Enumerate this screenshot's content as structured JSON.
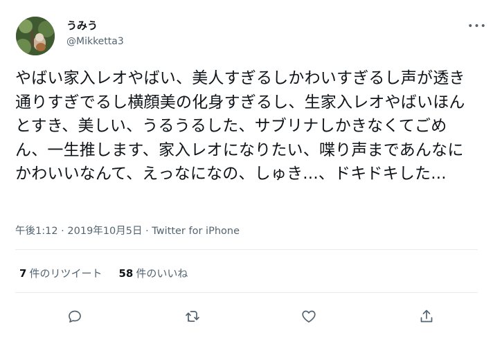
{
  "user": {
    "display_name": "うみう",
    "handle": "@Mikketta3"
  },
  "more_label": "•••",
  "tweet": {
    "text": "やばい家入レオやばい、美人すぎるしかわいすぎるし声が透き通りすぎでるし横顔美の化身すぎるし、生家入レオやばいほんとすき、美しい、うるうるした、サブリナしかきなくてごめん、一生推します、家入レオになりたい、喋り声まであんなにかわいいなんて、えっなになの、しゅき...、ドキドキした..."
  },
  "meta": {
    "time": "午後1:12",
    "separator1": " · ",
    "date": "2019年10月5日",
    "separator2": " · ",
    "source": "Twitter for iPhone"
  },
  "stats": {
    "retweets_count": "7",
    "retweets_label": "件のリツイート",
    "likes_count": "58",
    "likes_label": "件のいいね"
  },
  "icons": {
    "reply": "reply-icon",
    "retweet": "retweet-icon",
    "like": "heart-icon",
    "share": "share-icon"
  },
  "colors": {
    "text": "#0f1419",
    "secondary": "#536471",
    "divider": "#e6ecf0"
  }
}
